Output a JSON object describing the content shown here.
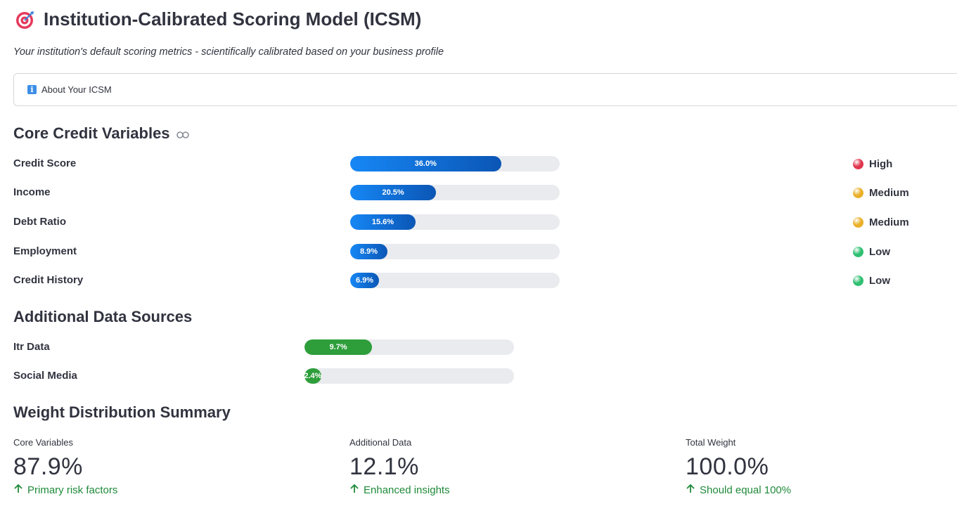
{
  "header": {
    "title": "Institution-Calibrated Scoring Model (ICSM)",
    "subtitle": "Your institution's default scoring metrics - scientifically calibrated based on your business profile",
    "icon": "target-icon"
  },
  "expander": {
    "label": "About Your ICSM",
    "icon": "info-icon"
  },
  "core": {
    "heading": "Core Credit Variables",
    "variables": [
      {
        "name": "Credit Score",
        "weight": 36.0,
        "label": "36.0%",
        "impact": "High",
        "impact_color": "#e0364e"
      },
      {
        "name": "Income",
        "weight": 20.5,
        "label": "20.5%",
        "impact": "Medium",
        "impact_color": "#eab02a"
      },
      {
        "name": "Debt Ratio",
        "weight": 15.6,
        "label": "15.6%",
        "impact": "Medium",
        "impact_color": "#eab02a"
      },
      {
        "name": "Employment",
        "weight": 8.9,
        "label": "8.9%",
        "impact": "Low",
        "impact_color": "#2fbf71"
      },
      {
        "name": "Credit History",
        "weight": 6.9,
        "label": "6.9%",
        "impact": "Low",
        "impact_color": "#2fbf71"
      }
    ]
  },
  "additional": {
    "heading": "Additional Data Sources",
    "sources": [
      {
        "name": "Itr Data",
        "weight": 9.7,
        "label": "9.7%"
      },
      {
        "name": "Social Media",
        "weight": 2.4,
        "label": "2.4%"
      }
    ]
  },
  "summary": {
    "heading": "Weight Distribution Summary",
    "metrics": [
      {
        "label": "Core Variables",
        "value": "87.9%",
        "delta": "Primary risk factors"
      },
      {
        "label": "Additional Data",
        "value": "12.1%",
        "delta": "Enhanced insights"
      },
      {
        "label": "Total Weight",
        "value": "100.0%",
        "delta": "Should equal 100%"
      }
    ]
  },
  "colors": {
    "accent_blue": "#0b56b5",
    "accent_green": "#2e9e3b",
    "delta_green": "#1f8a3a"
  }
}
